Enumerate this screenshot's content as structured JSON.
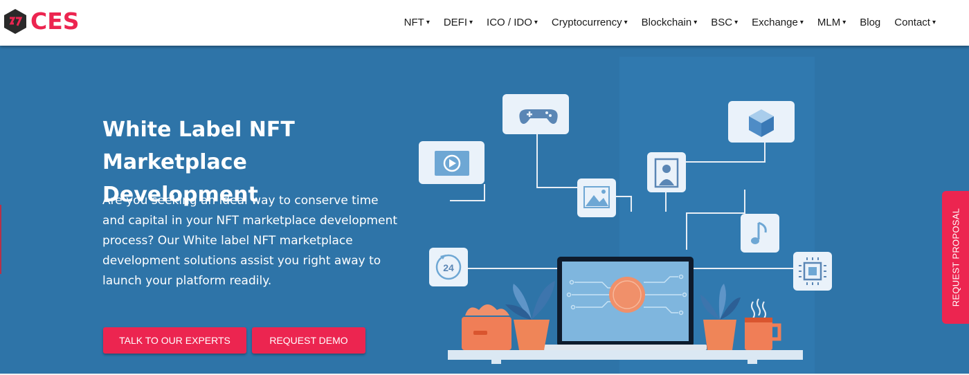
{
  "brand": {
    "name": "CES",
    "accent": "#ec2550"
  },
  "nav": {
    "items": [
      {
        "label": "NFT",
        "caret": "▾"
      },
      {
        "label": "DEFI",
        "caret": "▾"
      },
      {
        "label": "ICO / IDO",
        "caret": "▾"
      },
      {
        "label": "Cryptocurrency",
        "caret": "▾"
      },
      {
        "label": "Blockchain",
        "caret": "▾"
      },
      {
        "label": "BSC",
        "caret": "▾"
      },
      {
        "label": "Exchange",
        "caret": "▾"
      },
      {
        "label": "MLM",
        "caret": "▾"
      },
      {
        "label": "Blog",
        "caret": ""
      },
      {
        "label": "Contact",
        "caret": "▾"
      }
    ]
  },
  "hero": {
    "title": "White Label NFT Marketplace Development",
    "description": "Are you seeking an ideal way to conserve time and capital in your NFT marketplace development process? Our White label NFT marketplace development solutions assist you right away to launch your platform readily.",
    "background": "#2e74a8",
    "buttons": {
      "experts": "TALK TO OUR EXPERTS",
      "demo": "REQUEST DEMO"
    },
    "clock_label": "24"
  },
  "side_tab": {
    "label": "REQUEST PROPOSAL"
  },
  "icons": [
    "logo-hexagon-icon",
    "gamepad-icon",
    "video-play-icon",
    "image-icon",
    "portrait-icon",
    "cube-icon",
    "music-note-icon",
    "clock-24-icon",
    "chip-icon",
    "bitcoin-icon"
  ]
}
